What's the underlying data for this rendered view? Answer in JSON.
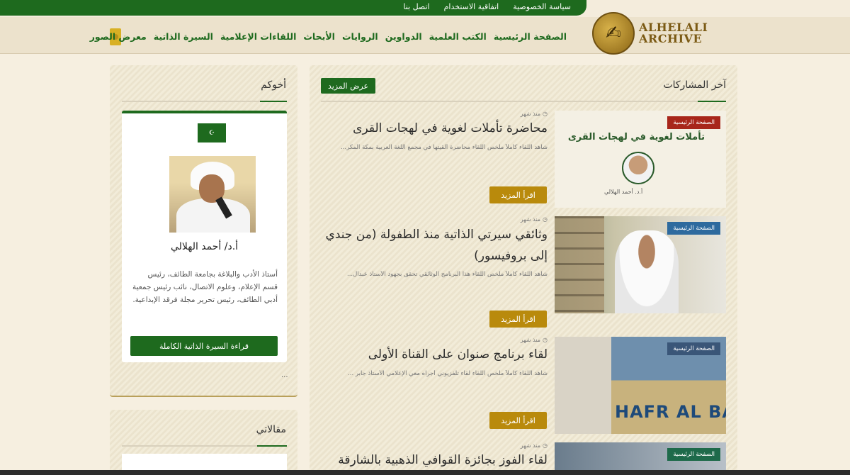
{
  "topbar": {
    "links": [
      "سياسة الخصوصية",
      "اتفاقية الاستخدام",
      "اتصل بنا"
    ]
  },
  "logo": {
    "line1": "ALHELALI",
    "line2": "ARCHIVE"
  },
  "nav": {
    "items": [
      "الصفحة الرئيسية",
      "الكتب العلمية",
      "الدواوين",
      "الروايات",
      "الأبحاث",
      "اللقاءات الإعلامية",
      "السيرة الذاتية",
      "معرض الصور"
    ]
  },
  "latest": {
    "title": "آخر المشاركات",
    "more_label": "عرض المزيد",
    "posts": [
      {
        "badge": "الصفحة الرئيسية",
        "badge_color": "#a8261b",
        "time": "منذ شهر",
        "title": "محاضرة تأملات لغوية في لهجات القرى",
        "excerpt": "شاهد اللقاء كاملاً ملخص اللقاء محاضرة ألقيتها في مجمع اللغة العربية بمكة المكر...",
        "read_more": "اقرأ المزيد",
        "image_caption": "تأملات لغوية في لهجات القرى",
        "image_sub": "أ.د. أحمد الهلالي"
      },
      {
        "badge": "الصفحة الرئيسية",
        "badge_color": "#2e6a9e",
        "time": "منذ شهر",
        "title": "وثائقي سيرتي الذاتية منذ الطفولة (من جندي إلى بروفيسور)",
        "excerpt": "شاهد اللقاء كاملاً ملخص اللقاء هذا البرنامج الوثائقي تحقق بجهود الأستاذ عبدال...",
        "read_more": "اقرأ المزيد"
      },
      {
        "badge": "الصفحة الرئيسية",
        "badge_color": "#3a5678",
        "time": "منذ شهر",
        "title": "لقاء برنامج صنوان على القناة الأولى",
        "excerpt": "شاهد اللقاء كاملاً ملخص اللقاء لقاء تلفزيوني أجراه معي الإعلامي الأستاذ جابر ...",
        "read_more": "اقرأ المزيد",
        "image_text": "HAFR AL BAT"
      },
      {
        "badge": "الصفحة الرئيسية",
        "badge_color": "#1e6a4a",
        "time": "منذ شهر",
        "title": "لقاء الفوز بجائزة القوافي الذهبية بالشارقة"
      }
    ]
  },
  "sidebar": {
    "title": "أخوكم",
    "flag_text": "☪",
    "name": "أ.د/ أحمد الهلالي",
    "bio": "أستاذ الأدب والبلاغة بجامعة الطائف، رئيس قسم الإعلام، وعلوم الاتصال، نائب رئيس جمعية أدبي الطائف، رئيس تحرير مجلة فرقد الإبداعية.",
    "bio_button": "قراءة السيرة الذاتية الكاملة",
    "ellipsis": "...",
    "articles_title": "مقالاتي"
  }
}
